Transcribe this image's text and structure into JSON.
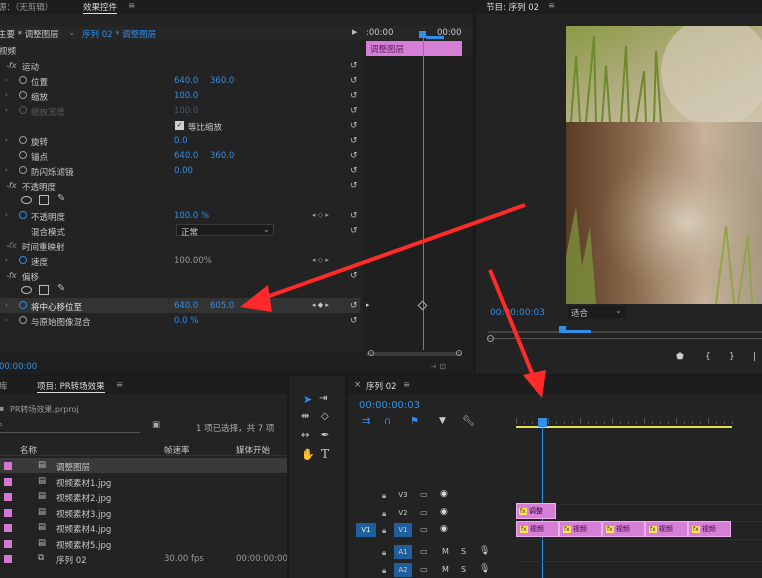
{
  "effect_controls": {
    "tab_source": "源：（无剪辑）",
    "tab_effect": "效果控件",
    "tab_menu": "≡",
    "master_label": "主要 * 调整图层",
    "seq_label": "序列 02 * 调整图层",
    "section_video": "视频",
    "tl_start": ":00:00",
    "tl_end": "00:00",
    "tl_clip_label": "调整图层",
    "motion": "运动",
    "position": "位置",
    "position_x": "640.0",
    "position_y": "360.0",
    "scale": "缩放",
    "scale_v": "100.0",
    "scale_w": "缩放宽度",
    "scale_w_v": "100.0",
    "uniform": "等比缩放",
    "rotation": "旋转",
    "rotation_v": "0.0",
    "anchor": "锚点",
    "anchor_x": "640.0",
    "anchor_y": "360.0",
    "flicker": "防闪烁滤镜",
    "flicker_v": "0.00",
    "opacity_group": "不透明度",
    "opacity": "不透明度",
    "opacity_v": "100.0 %",
    "blend": "混合模式",
    "blend_v": "正常",
    "time_remap": "时间重映射",
    "speed": "速度",
    "speed_v": "100.00%",
    "offset_group": "偏移",
    "shift_center": "将中心移位至",
    "shift_x": "640.0",
    "shift_y": "605.0",
    "blend_original": "与原始图像混合",
    "blend_original_v": "0.0 %",
    "bottom_time": "00:00:00"
  },
  "program": {
    "title": "节目: 序列 02",
    "menu": "≡",
    "timecode": "00:00:00:03",
    "fit": "适合"
  },
  "project": {
    "tab_lib": "库",
    "tab_project": "项目: PR转场效果",
    "menu": "≡",
    "file": "PR转场效果.prproj",
    "selection": "1 项已选择，共 7 项",
    "col_name": "名称",
    "col_fps": "帧速率",
    "col_start": "媒体开始",
    "items": [
      {
        "name": "调整图层",
        "fps": "",
        "start": ""
      },
      {
        "name": "视频素材1.jpg",
        "fps": "",
        "start": ""
      },
      {
        "name": "视频素材2.jpg",
        "fps": "",
        "start": ""
      },
      {
        "name": "视频素材3.jpg",
        "fps": "",
        "start": ""
      },
      {
        "name": "视频素材4.jpg",
        "fps": "",
        "start": ""
      },
      {
        "name": "视频素材5.jpg",
        "fps": "",
        "start": ""
      },
      {
        "name": "序列 02",
        "fps": "30.00 fps",
        "start": "00:00:00:00"
      }
    ]
  },
  "timeline": {
    "tab": "序列 02",
    "menu": "≡",
    "timecode": "00:00:00:03",
    "tracks": [
      "V3",
      "V2",
      "V1",
      "A1",
      "A2"
    ],
    "src_v1": "V1",
    "adj_clip": "调整",
    "clip_label": "视频"
  },
  "colors": {
    "accent": "#2f8fea",
    "clip": "#d67fd6",
    "arrow": "#ff2a2a"
  }
}
